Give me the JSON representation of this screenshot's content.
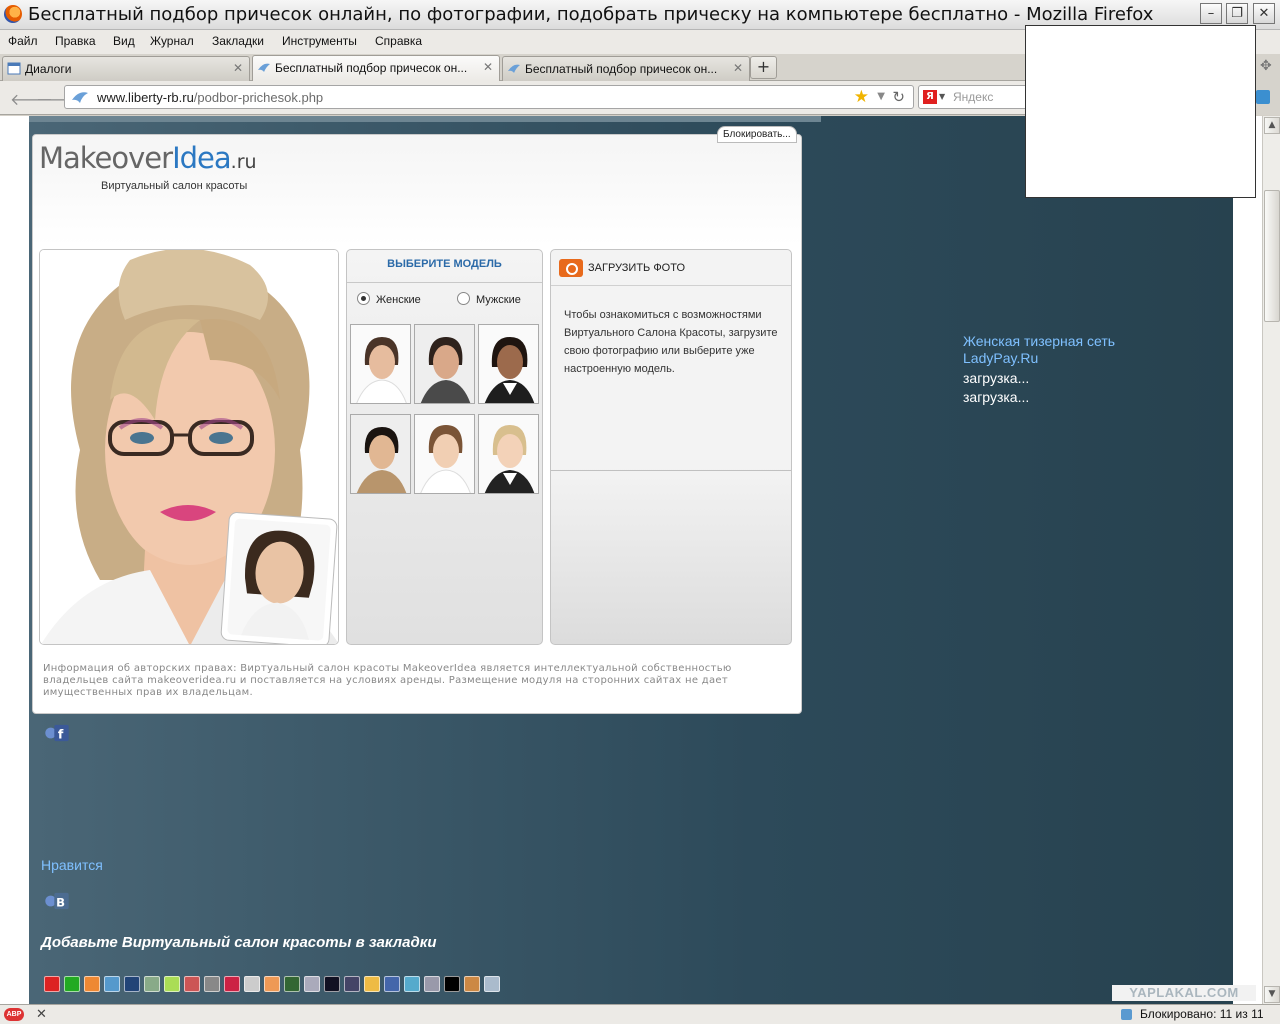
{
  "window": {
    "title": "Бесплатный подбор причесок онлайн, по фотографии, подобрать прическу на компьютере бесплатно - Mozilla Firefox"
  },
  "menu": [
    "Файл",
    "Правка",
    "Вид",
    "Журнал",
    "Закладки",
    "Инструменты",
    "Справка"
  ],
  "tabs": [
    {
      "label": "Диалоги",
      "active": false
    },
    {
      "label": "Бесплатный подбор причесок он...",
      "active": true
    },
    {
      "label": "Бесплатный подбор причесок он...",
      "active": false
    }
  ],
  "newtab_label": "+",
  "address": {
    "url_host": "www.liberty-rb.ru",
    "url_path": "/podbor-prichesok.php"
  },
  "search": {
    "engine": "Я",
    "placeholder": "Яндекс"
  },
  "widget": {
    "block_label": "Блокировать...",
    "logo_makeover": "Makeover",
    "logo_idea": "Idea",
    "logo_ru": ".ru",
    "tagline": "Виртуальный салон красоты",
    "models_title": "ВЫБЕРИТЕ МОДЕЛЬ",
    "radio_female": "Женские",
    "radio_male": "Мужские",
    "upload_title": "ЗАГРУЗИТЬ ФОТО",
    "upload_text": "Чтобы ознакомиться с возможностями Виртуального Салона Красоты, загрузите свою фотографию или выберите уже настроенную модель.",
    "copyright": "Информация об авторских правах: Виртуальный салон красоты MakeoverIdea является интеллектуальной собственностью владельцев сайта makeoveridea.ru и поставляется на условиях аренды. Размещение модуля на сторонних сайтах не дает имущественных прав их владельцам."
  },
  "ads": {
    "link_line1": "Женская тизерная сеть",
    "link_line2": "LadyPay.Ru",
    "loading1": "загрузка...",
    "loading2": "загрузка..."
  },
  "social": {
    "likes": "Нравится",
    "bookmark_title": "Добавьте Виртуальный салон красоты в закладки"
  },
  "watermark": "YAPLAKAL.COM",
  "status": {
    "abp": "ABP",
    "close": "✕",
    "blocked": "Блокировано: 11 из 11"
  },
  "colors": {
    "page_bg": "#2d4a5a",
    "link": "#7fc0ff",
    "logo_blue": "#2b78c2",
    "camera_orange": "#e86a1c"
  }
}
